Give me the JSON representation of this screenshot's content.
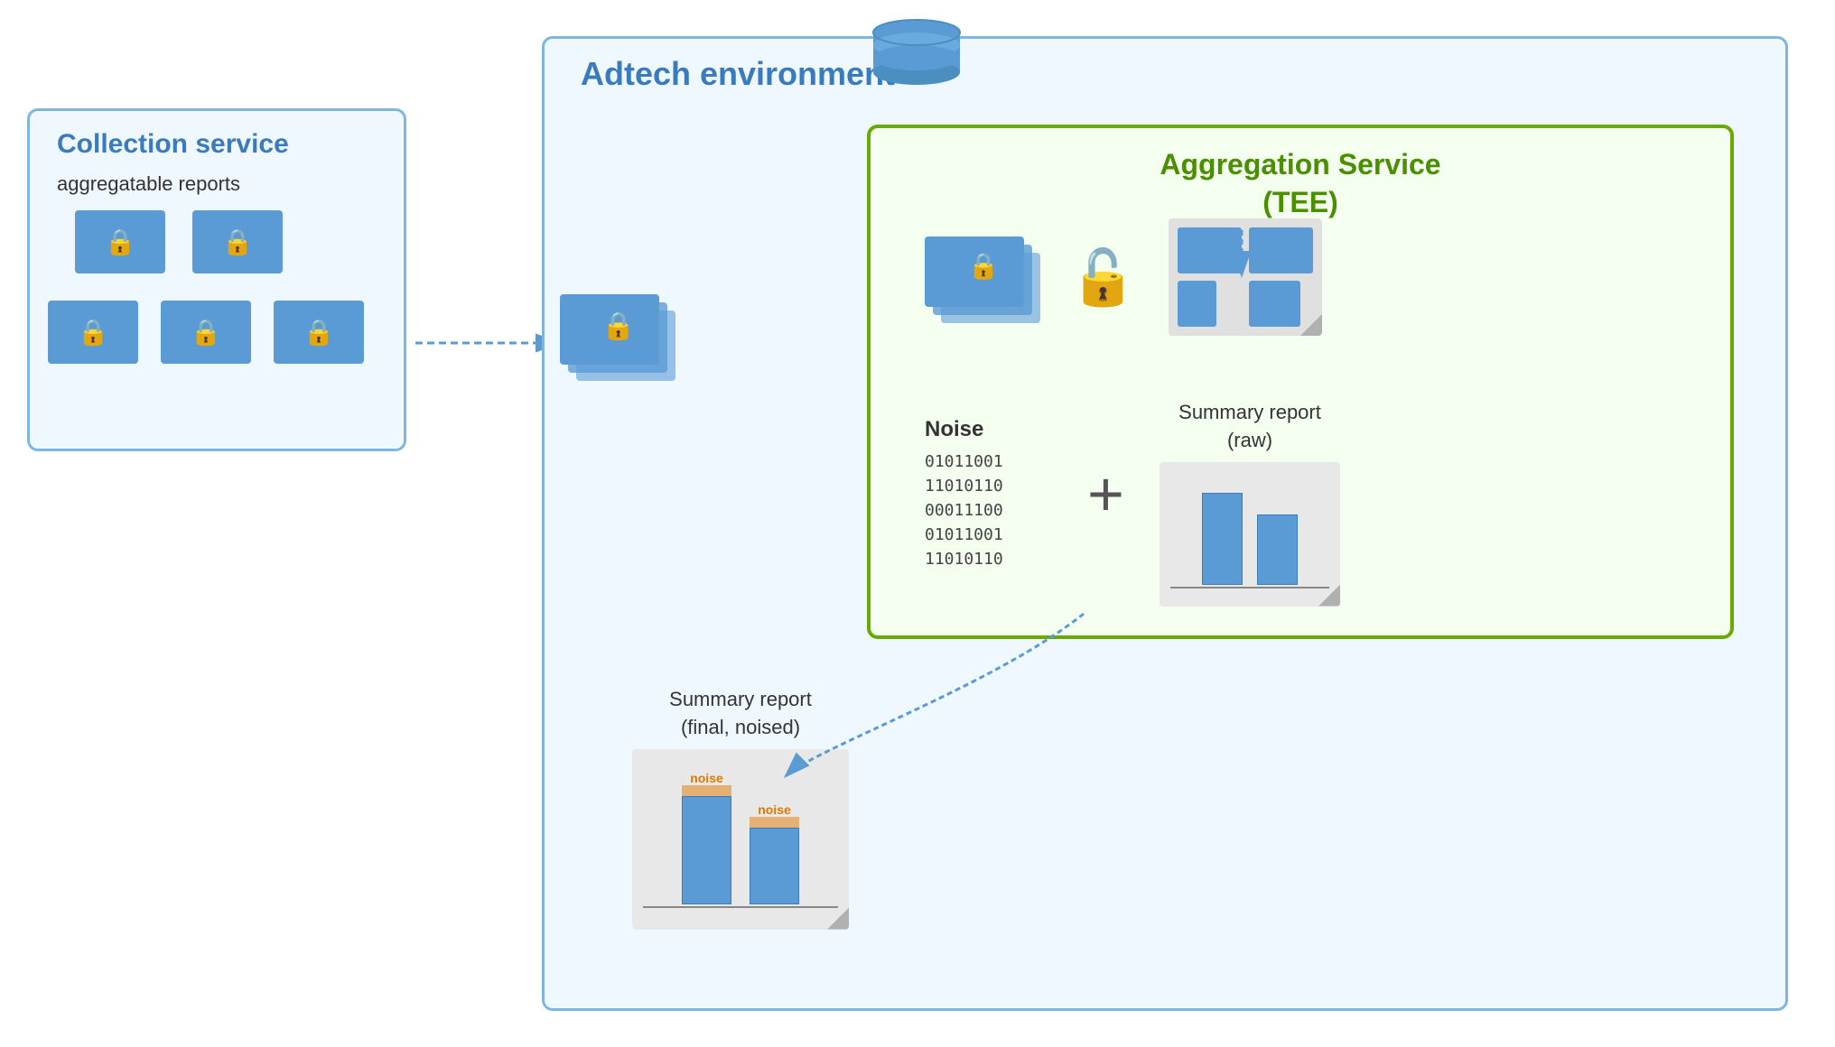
{
  "adtech": {
    "title": "Adtech environment"
  },
  "collection_service": {
    "title": "Collection service",
    "subtitle": "aggregatable reports"
  },
  "aggregation_tee": {
    "title": "Aggregation Service",
    "subtitle": "(TEE)"
  },
  "noise": {
    "label": "Noise",
    "binary_lines": [
      "01011001",
      "11010110",
      "00011100",
      "01011001",
      "11010110"
    ]
  },
  "summary_raw": {
    "label": "Summary report",
    "sublabel": "(raw)"
  },
  "summary_final": {
    "label": "Summary report",
    "sublabel": "(final, noised)"
  },
  "noise_bar1": "noise",
  "noise_bar2": "noise",
  "colors": {
    "blue_border": "#7eb6e0",
    "green_border": "#6aaa00",
    "doc_blue": "#5b9bd5",
    "adtech_title": "#3a7abf",
    "tee_title": "#4a8f00",
    "noise_label_color": "#e07800"
  }
}
